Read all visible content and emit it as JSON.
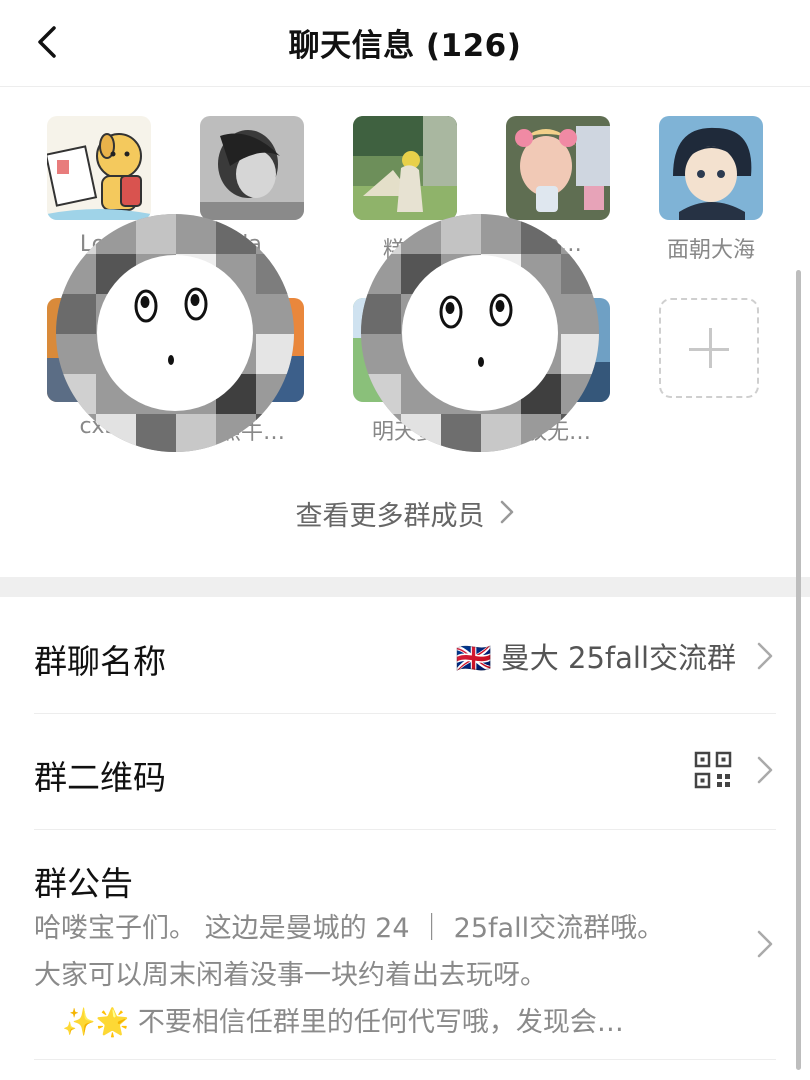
{
  "header": {
    "title": "聊天信息 (126)",
    "back_icon": "chevron-left-icon"
  },
  "members": [
    {
      "name": "Lov"
    },
    {
      "name": "la"
    },
    {
      "name": "糕冷"
    },
    {
      "name": "lia…"
    },
    {
      "name": "面朝大海"
    },
    {
      "name": "cx3"
    },
    {
      "name": "焦牛…"
    },
    {
      "name": "明天要"
    },
    {
      "name": "放无…"
    }
  ],
  "add_member_icon": "plus-icon",
  "view_more": {
    "label": "查看更多群成员",
    "icon": "chevron-right-icon"
  },
  "settings": {
    "group_name": {
      "label": "群聊名称",
      "flag": "🇬🇧",
      "value": "曼大 25fall交流群"
    },
    "qr_code": {
      "label": "群二维码",
      "icon": "qr-code-icon"
    },
    "notice": {
      "label": "群公告",
      "line1": "哈喽宝子们。 这边是曼城的 24 ｜ 25fall交流群哦。",
      "line2": "大家可以周末闲着没事一块约着出去玩呀。",
      "line3": "✨🌟  不要相信任群里的任何代写哦，发现会…"
    }
  },
  "colors": {
    "accent_divider": "#efefef",
    "secondary_text": "#888888"
  }
}
